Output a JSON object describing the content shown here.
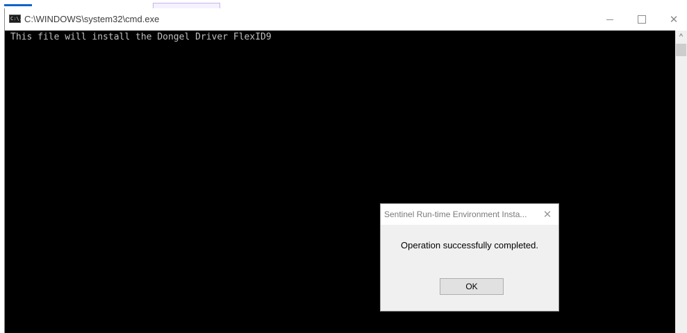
{
  "window": {
    "title": "C:\\WINDOWS\\system32\\cmd.exe",
    "icon": "cmd-icon",
    "icon_text": "C:\\."
  },
  "console": {
    "lines": [
      "This file will install the Dongel Driver FlexID9"
    ]
  },
  "dialog": {
    "title": "Sentinel Run-time Environment Insta...",
    "message": "Operation successfully completed.",
    "ok_label": "OK"
  },
  "colors": {
    "console_bg": "#000000",
    "console_text": "#c0c0c0",
    "dialog_bg": "#f0f0f0",
    "accent": "#0a64c8"
  }
}
